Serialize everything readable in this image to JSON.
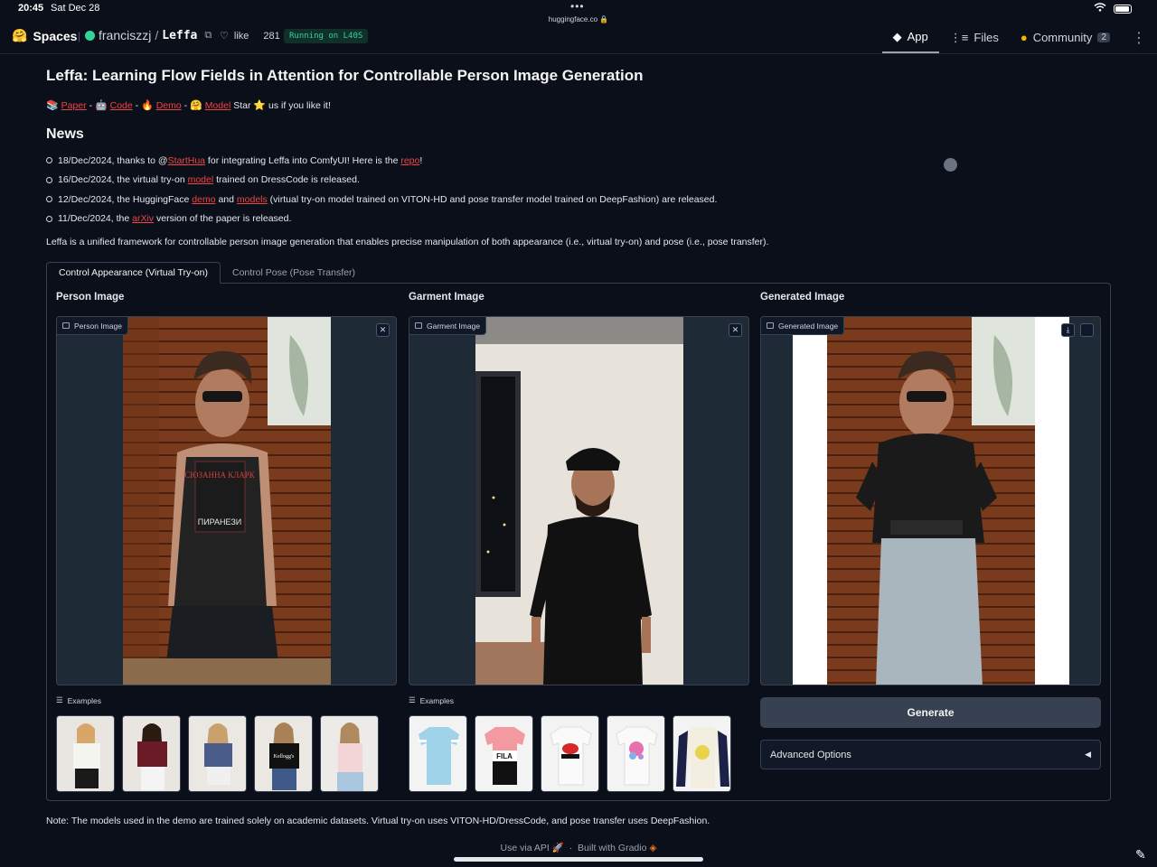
{
  "status": {
    "time": "20:45",
    "date": "Sat Dec 28",
    "url": "huggingface.co"
  },
  "header": {
    "spaces_label": "Spaces",
    "owner": "franciszzj",
    "repo": "Leffa",
    "like_label": "like",
    "like_count": "281",
    "running": "Running on L40S",
    "nav": [
      {
        "label": "App",
        "icon": "app-icon"
      },
      {
        "label": "Files",
        "icon": "files-icon"
      },
      {
        "label": "Community",
        "icon": "community-icon",
        "badge": "2"
      }
    ]
  },
  "page": {
    "title": "Leffa: Learning Flow Fields in Attention for Controllable Person Image Generation",
    "links": {
      "paper": "Paper",
      "code": "Code",
      "demo": "Demo",
      "model": "Model",
      "star_text": "Star",
      "star_suffix": "us if you like it!"
    },
    "news_heading": "News",
    "news": [
      {
        "a": "18/Dec/2024, thanks to @",
        "l1": "StartHua",
        "b": " for integrating Leffa into ComfyUI! Here is the ",
        "l2": "repo",
        "c": "!"
      },
      {
        "a": "16/Dec/2024, the virtual try-on ",
        "l1": "model",
        "b": " trained on DressCode is released."
      },
      {
        "a": "12/Dec/2024, the HuggingFace ",
        "l1": "demo",
        "b": " and ",
        "l2": "models",
        "c": " (virtual try-on model trained on VITON-HD and pose transfer model trained on DeepFashion) are released."
      },
      {
        "a": "11/Dec/2024, the ",
        "l1": "arXiv",
        "b": " version of the paper is released."
      }
    ],
    "description": "Leffa is a unified framework for controllable person image generation that enables precise manipulation of both appearance (i.e., virtual try-on) and pose (i.e., pose transfer).",
    "tabs": [
      "Control Appearance (Virtual Try-on)",
      "Control Pose (Pose Transfer)"
    ],
    "columns": {
      "person_label": "Person Image",
      "garment_label": "Garment Image",
      "generated_label": "Generated Image",
      "person_tag": "Person Image",
      "garment_tag": "Garment Image",
      "generated_tag": "Generated Image"
    },
    "examples_label": "Examples",
    "book_text_1": "СЮЗАННА КЛАРК",
    "book_text_2": "ПИРАНЕЗИ",
    "shirt_text_1": "Kellogg's",
    "shirt_text_2": "FILA",
    "generate_label": "Generate",
    "advanced_label": "Advanced Options",
    "note": "Note: The models used in the demo are trained solely on academic datasets. Virtual try-on uses VITON-HD/DressCode, and pose transfer uses DeepFashion.",
    "footer_api": "Use via API",
    "footer_built": "Built with Gradio"
  }
}
